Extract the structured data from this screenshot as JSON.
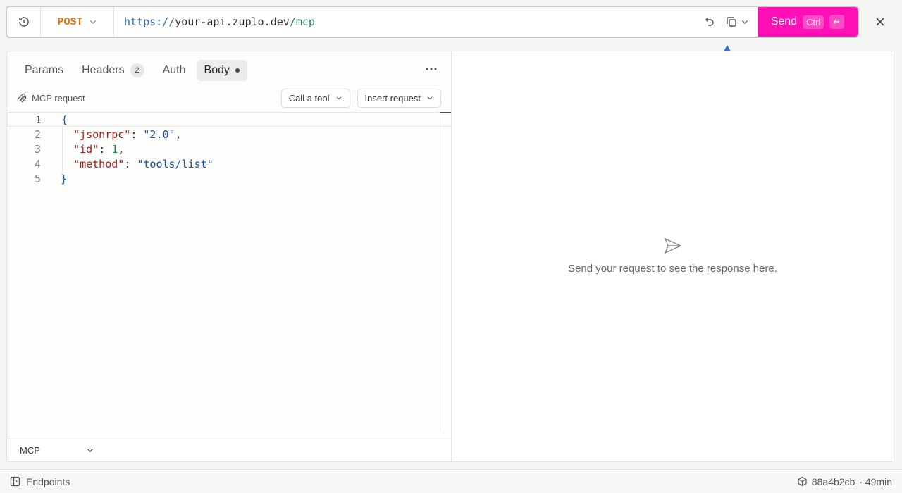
{
  "toolbar": {
    "method": "POST",
    "url": {
      "scheme": "https://",
      "host": "your-api.zuplo.dev",
      "path": "/mcp"
    },
    "send_label": "Send",
    "send_shortcut": "Ctrl",
    "send_enter": "↵"
  },
  "tabs": {
    "params": "Params",
    "headers": "Headers",
    "headers_count": "2",
    "auth": "Auth",
    "body": "Body"
  },
  "body": {
    "mcp_label": "MCP request",
    "call_tool": "Call a tool",
    "insert_request": "Insert request",
    "lines": [
      {
        "num": "1",
        "text": "{"
      },
      {
        "num": "2",
        "key": "\"jsonrpc\"",
        "value": "\"2.0\""
      },
      {
        "num": "3",
        "key": "\"id\"",
        "value": "1"
      },
      {
        "num": "4",
        "key": "\"method\"",
        "value": "\"tools/list\""
      },
      {
        "num": "5",
        "text": "}"
      }
    ],
    "body_type": "MCP"
  },
  "response": {
    "empty_text": "Send your request to see the response here."
  },
  "status": {
    "endpoints": "Endpoints",
    "commit": "88a4b2cb",
    "age": "· 49min"
  },
  "colors": {
    "accent": "#ff0fb6",
    "method": "#d9731b",
    "annotation_arrow": "#2f6fe0"
  }
}
